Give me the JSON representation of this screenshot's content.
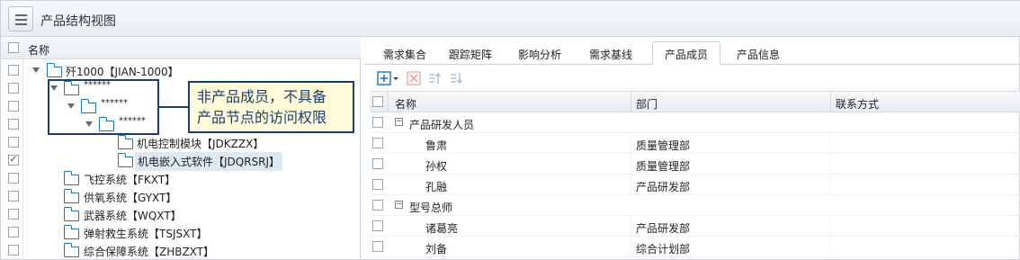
{
  "window": {
    "title": "产品结构视图"
  },
  "tree": {
    "header": "名称",
    "nodes": [
      {
        "label": "歼1000【JIAN-1000】",
        "checked": false
      },
      {
        "label": "******",
        "checked": false
      },
      {
        "label": "******",
        "checked": false
      },
      {
        "label": "******",
        "checked": false
      },
      {
        "label": "机电控制模块【JDKZZX】",
        "checked": false
      },
      {
        "label": "机电嵌入式软件【JDQRSRJ】",
        "checked": true
      },
      {
        "label": "飞控系统【FKXT】",
        "checked": false
      },
      {
        "label": "供氧系统【GYXT】",
        "checked": false
      },
      {
        "label": "武器系统【WQXT】",
        "checked": false
      },
      {
        "label": "弹射救生系统【TSJSXT】",
        "checked": false
      },
      {
        "label": "综合保障系统【ZHBZXT】",
        "checked": false
      }
    ]
  },
  "annotation": {
    "line1": "非产品成员，不具备",
    "line2": "产品节点的访问权限"
  },
  "tabs": [
    "需求集合",
    "跟踪矩阵",
    "影响分析",
    "需求基线",
    "产品成员",
    "产品信息"
  ],
  "active_tab": "产品成员",
  "grid": {
    "columns": [
      "名称",
      "部门",
      "联系方式"
    ],
    "groups": [
      {
        "label": "产品研发人员",
        "members": [
          {
            "name": "鲁肃",
            "dept": "质量管理部"
          },
          {
            "name": "孙权",
            "dept": "质量管理部"
          },
          {
            "name": "孔融",
            "dept": "产品研发部"
          }
        ]
      },
      {
        "label": "型号总师",
        "members": [
          {
            "name": "诸葛亮",
            "dept": "产品研发部"
          },
          {
            "name": "刘备",
            "dept": "综合计划部"
          }
        ]
      }
    ]
  },
  "colors": {
    "accent": "#1e73be",
    "annotation_border": "#1c3d6e",
    "annotation_fill": "#fffbd9",
    "selection": "#dde8f5"
  },
  "icons": [
    "menu-icon",
    "folder-icon",
    "expand-triangle-icon",
    "add-icon",
    "dropdown-arrow-icon",
    "delete-icon",
    "move-up-icon",
    "move-down-icon",
    "collapse-icon"
  ]
}
